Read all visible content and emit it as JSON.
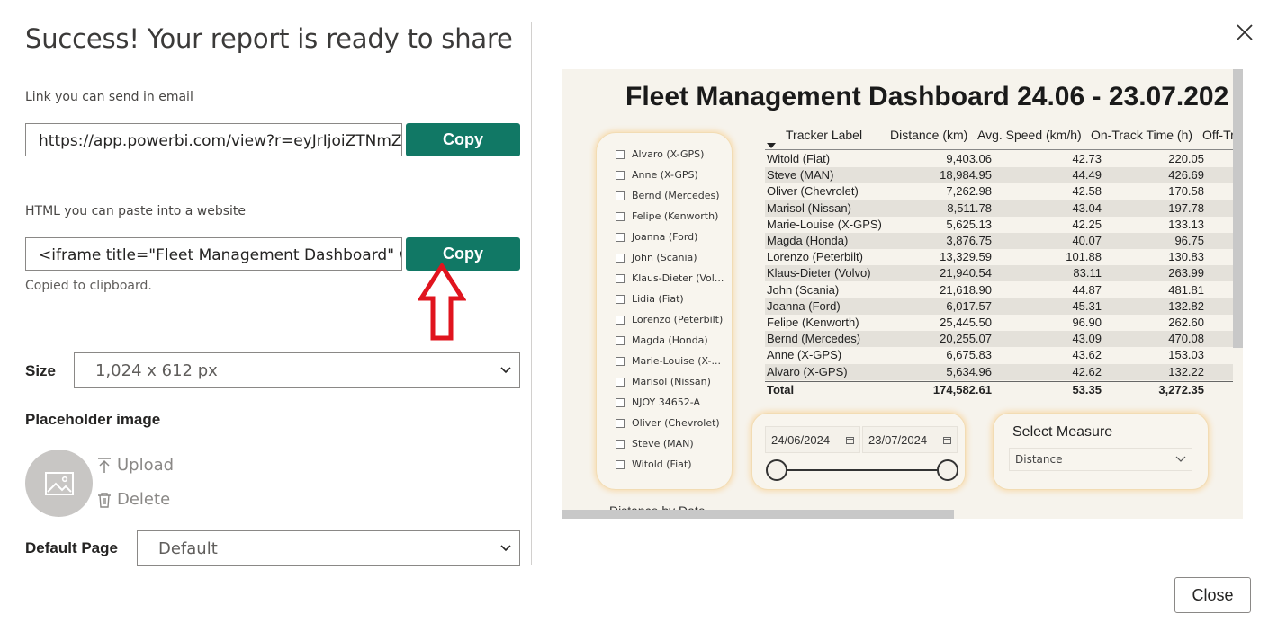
{
  "dialog": {
    "title": "Success! Your report is ready to share",
    "close_label": "Close",
    "accent_color": "#117865"
  },
  "email_link": {
    "label": "Link you can send in email",
    "value": "https://app.powerbi.com/view?r=eyJrIjoiZTNmZV",
    "copy_label": "Copy"
  },
  "embed_html": {
    "label": "HTML you can paste into a website",
    "value": "<iframe title=\"Fleet Management Dashboard\" wi",
    "copy_label": "Copy",
    "status": "Copied to clipboard."
  },
  "size": {
    "label": "Size",
    "selected": "1,024 x 612 px"
  },
  "placeholder_image": {
    "label": "Placeholder image",
    "upload_label": "Upload",
    "delete_label": "Delete"
  },
  "default_page": {
    "label": "Default Page",
    "selected": "Default"
  },
  "preview": {
    "title": "Fleet Management Dashboard 24.06 - 23.07.202",
    "slicer_items": [
      "Alvaro (X-GPS)",
      "Anne (X-GPS)",
      "Bernd (Mercedes)",
      "Felipe (Kenworth)",
      "Joanna (Ford)",
      "John (Scania)",
      "Klaus-Dieter (Vol...",
      "Lidia (Fiat)",
      "Lorenzo (Peterbilt)",
      "Magda (Honda)",
      "Marie-Louise (X-...",
      "Marisol (Nissan)",
      "NJOY 34652-A",
      "Oliver (Chevrolet)",
      "Steve (MAN)",
      "Witold (Fiat)"
    ],
    "table": {
      "sort_icon": "sort-descending-icon",
      "headers": [
        "Tracker Label",
        "Distance (km)",
        "Avg. Speed (km/h)",
        "On-Track Time (h)",
        "Off-Tr"
      ],
      "rows": [
        [
          "Witold (Fiat)",
          "9,403.06",
          "42.73",
          "220.05"
        ],
        [
          "Steve (MAN)",
          "18,984.95",
          "44.49",
          "426.69"
        ],
        [
          "Oliver (Chevrolet)",
          "7,262.98",
          "42.58",
          "170.58"
        ],
        [
          "Marisol (Nissan)",
          "8,511.78",
          "43.04",
          "197.78"
        ],
        [
          "Marie-Louise (X-GPS)",
          "5,625.13",
          "42.25",
          "133.13"
        ],
        [
          "Magda (Honda)",
          "3,876.75",
          "40.07",
          "96.75"
        ],
        [
          "Lorenzo (Peterbilt)",
          "13,329.59",
          "101.88",
          "130.83"
        ],
        [
          "Klaus-Dieter (Volvo)",
          "21,940.54",
          "83.11",
          "263.99"
        ],
        [
          "John (Scania)",
          "21,618.90",
          "44.87",
          "481.81"
        ],
        [
          "Joanna (Ford)",
          "6,017.57",
          "45.31",
          "132.82"
        ],
        [
          "Felipe (Kenworth)",
          "25,445.50",
          "96.90",
          "262.60"
        ],
        [
          "Bernd (Mercedes)",
          "20,255.07",
          "43.09",
          "470.08"
        ],
        [
          "Anne (X-GPS)",
          "6,675.83",
          "43.62",
          "153.03"
        ],
        [
          "Alvaro (X-GPS)",
          "5,634.96",
          "42.62",
          "132.22"
        ]
      ],
      "total": [
        "Total",
        "174,582.61",
        "53.35",
        "3,272.35"
      ]
    },
    "date_range": {
      "start": "24/06/2024",
      "end": "23/07/2024"
    },
    "measure": {
      "title": "Select Measure",
      "selected": "Distance"
    },
    "bottom_caption": "Distance by Date"
  }
}
